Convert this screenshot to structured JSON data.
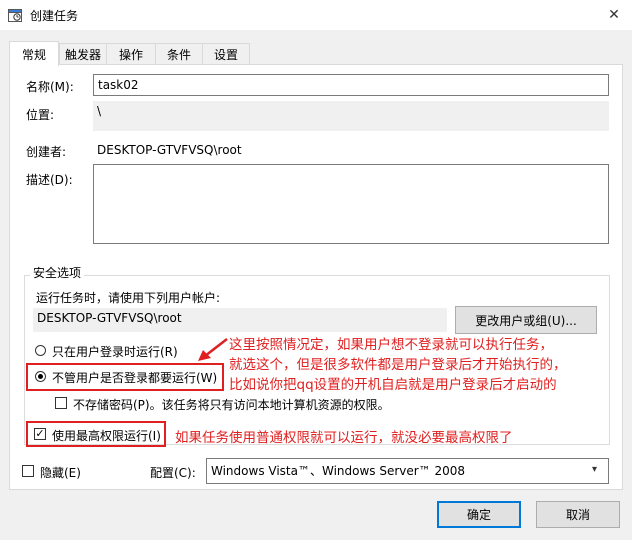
{
  "window": {
    "title": "创建任务",
    "close_glyph": "✕"
  },
  "tabs": [
    {
      "label": "常规",
      "active": true
    },
    {
      "label": "触发器"
    },
    {
      "label": "操作"
    },
    {
      "label": "条件"
    },
    {
      "label": "设置"
    }
  ],
  "general": {
    "name_label": "名称(M):",
    "name_value": "task02",
    "location_label": "位置:",
    "location_value": "\\",
    "author_label": "创建者:",
    "author_value": "DESKTOP-GTVFVSQ\\root",
    "description_label": "描述(D):",
    "description_value": ""
  },
  "security": {
    "group_label": "安全选项",
    "run_as_label": "运行任务时，请使用下列用户帐户:",
    "account_value": "DESKTOP-GTVFVSQ\\root",
    "change_user_button": "更改用户或组(U)...",
    "radio_logged_on": "只在用户登录时运行(R)",
    "radio_whether_logged": "不管用户是否登录都要运行(W)",
    "do_not_store_password": "不存储密码(P)。该任务将只有访问本地计算机资源的权限。",
    "highest_privileges": "使用最高权限运行(I)"
  },
  "annotations": {
    "arrow_note_lines": [
      "这里按照情况定，如果用户想不登录就可以执行任务，",
      "就选这个，但是很多软件都是用户登录后才开始执行的，",
      "比如说你把qq设置的开机自启就是用户登录后才启动的"
    ],
    "privilege_note": "如果任务使用普通权限就可以运行，就没必要最高权限了",
    "color": "#e02020"
  },
  "footer": {
    "hidden_label": "隐藏(E)",
    "configure_label": "配置(C):",
    "configure_value": "Windows Vista™、Windows Server™ 2008",
    "ok_button": "确定",
    "cancel_button": "取消"
  },
  "colors": {
    "accent": "#0078d7",
    "annotation": "#e02020"
  }
}
